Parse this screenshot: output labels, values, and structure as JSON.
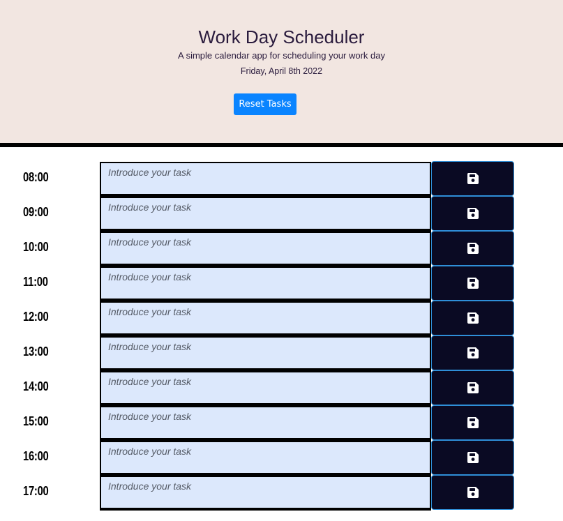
{
  "header": {
    "title": "Work Day Scheduler",
    "subtitle": "A simple calendar app for scheduling your work day",
    "date": "Friday, April 8th 2022",
    "reset_label": "Reset Tasks"
  },
  "task_placeholder": "Introduce your task",
  "save_icon": "floppy-disk-icon",
  "colors": {
    "header_bg": "#f2e6e1",
    "task_bg": "#dce8fc",
    "save_bg": "#0a0a23",
    "reset_bg": "#0a84ff"
  },
  "rows": [
    {
      "hour": "08:00",
      "task": ""
    },
    {
      "hour": "09:00",
      "task": ""
    },
    {
      "hour": "10:00",
      "task": ""
    },
    {
      "hour": "11:00",
      "task": ""
    },
    {
      "hour": "12:00",
      "task": ""
    },
    {
      "hour": "13:00",
      "task": ""
    },
    {
      "hour": "14:00",
      "task": ""
    },
    {
      "hour": "15:00",
      "task": ""
    },
    {
      "hour": "16:00",
      "task": ""
    },
    {
      "hour": "17:00",
      "task": ""
    }
  ]
}
